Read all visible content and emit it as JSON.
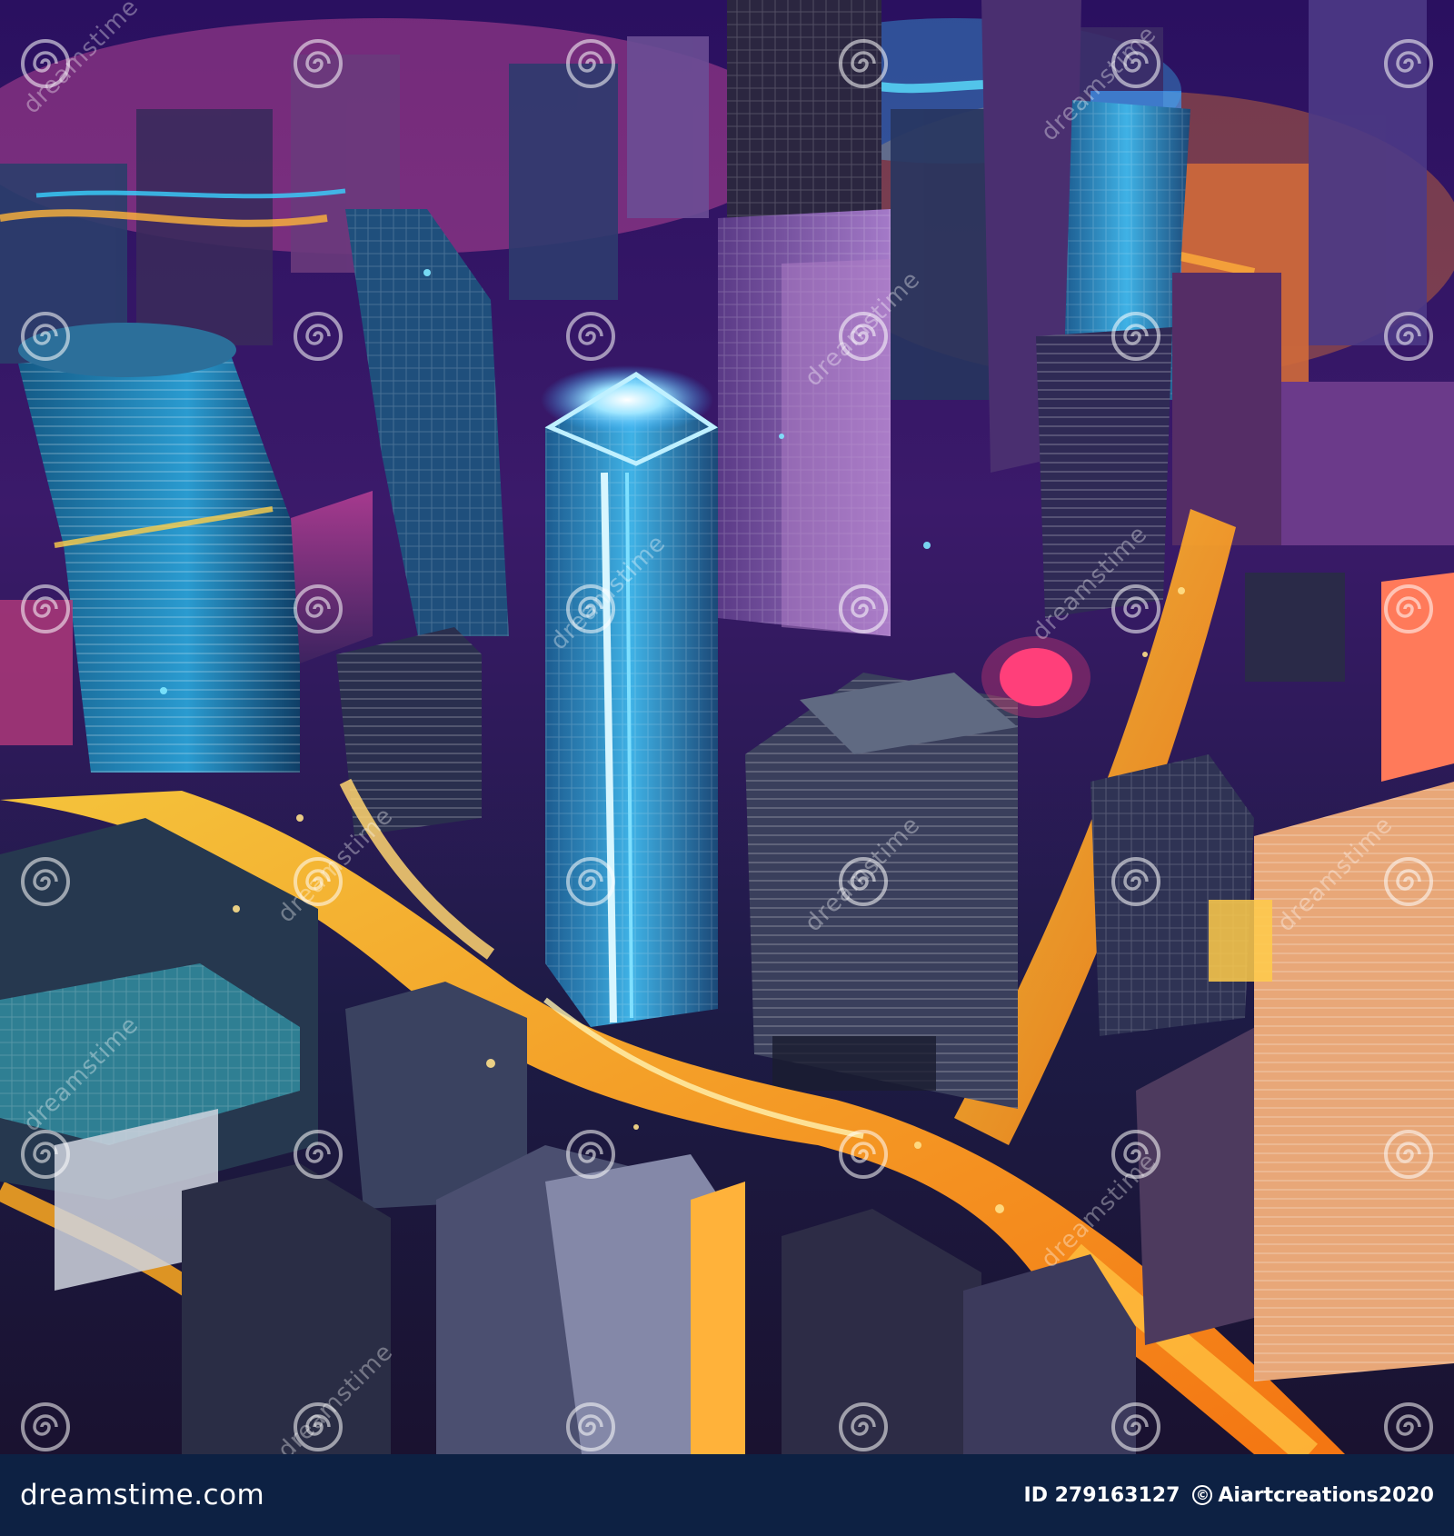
{
  "watermark": {
    "text": "dreamstime",
    "icon": "dreamstime-spiral-icon"
  },
  "footer": {
    "logo_text": "dreamstime.com",
    "image_id": "ID 279163127",
    "author": "Aiartcreations2020",
    "copyright_icon": "copyright-icon",
    "background_color": "#0d2143"
  },
  "colors": {
    "neon_blue": "#35c8ff",
    "neon_orange": "#ffa31a",
    "neon_magenta": "#ff3fa8",
    "neon_purple": "#8a3cff"
  }
}
